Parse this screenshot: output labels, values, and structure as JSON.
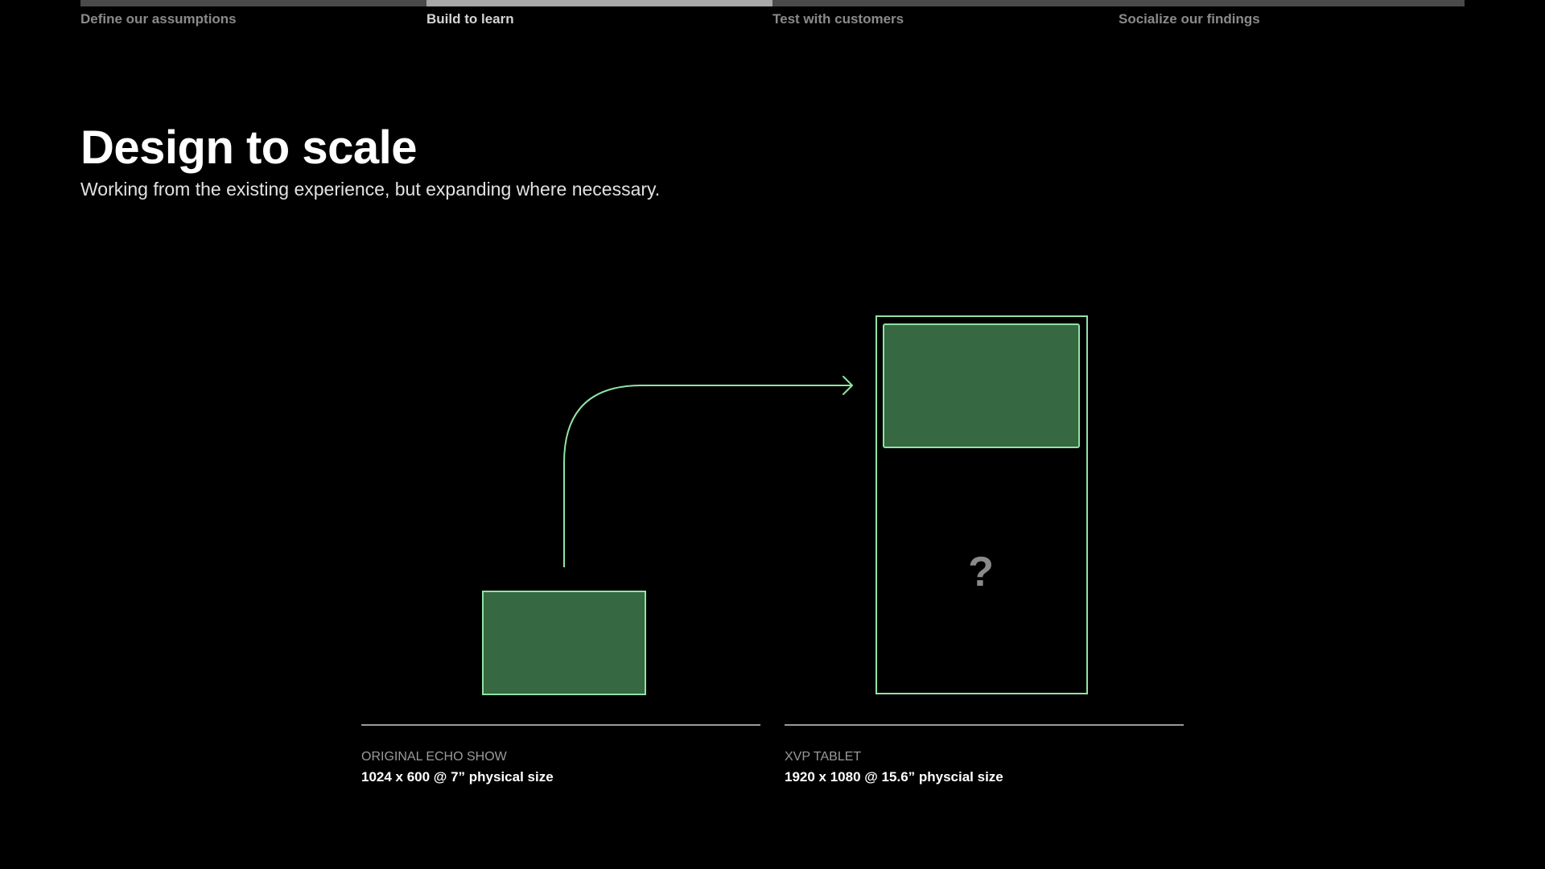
{
  "steps": [
    {
      "label": "Define our assumptions",
      "active": false
    },
    {
      "label": "Build to learn",
      "active": true
    },
    {
      "label": "Test with customers",
      "active": false
    },
    {
      "label": "Socialize our findings",
      "active": false
    }
  ],
  "header": {
    "title": "Design to scale",
    "subtitle": "Working from the existing experience, but expanding where necessary."
  },
  "diagram": {
    "unknown_mark": "?",
    "colors": {
      "outline": "#8fe3a3",
      "fill": "#366841",
      "mark": "#8a8a8a"
    }
  },
  "devices": [
    {
      "name": "Original Echo Show",
      "spec": "1024 x 600 @ 7” physical size"
    },
    {
      "name": "XVP Tablet",
      "spec": "1920 x 1080 @ 15.6” physcial size"
    }
  ]
}
